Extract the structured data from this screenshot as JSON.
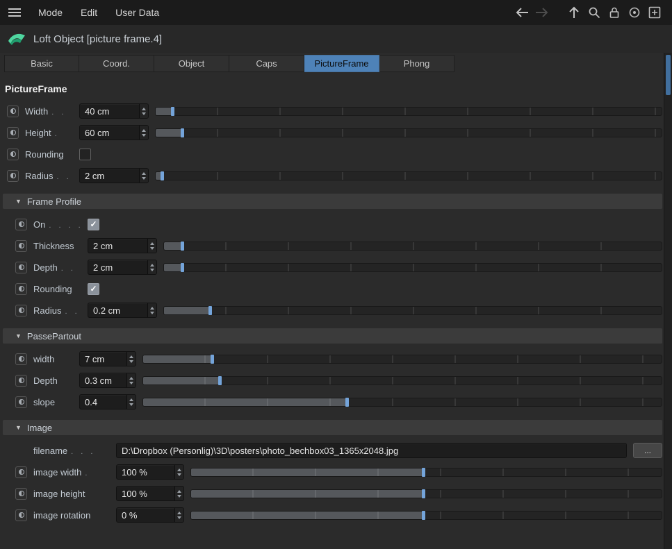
{
  "menubar": {
    "items": [
      "Mode",
      "Edit",
      "User Data"
    ],
    "icons": [
      "hamburger-icon",
      "back-icon",
      "forward-icon",
      "up-icon",
      "search-icon",
      "lock-icon",
      "target-icon",
      "add-box-icon"
    ]
  },
  "header": {
    "icon": "loft-object-icon",
    "title": "Loft Object [picture frame.4]"
  },
  "tabs": [
    {
      "label": "Basic",
      "selected": false
    },
    {
      "label": "Coord.",
      "selected": false
    },
    {
      "label": "Object",
      "selected": false
    },
    {
      "label": "Caps",
      "selected": false
    },
    {
      "label": "PictureFrame",
      "selected": true
    },
    {
      "label": "Phong",
      "selected": false
    }
  ],
  "panel": {
    "heading": "PictureFrame",
    "top": {
      "width": {
        "label": "Width",
        "leader": ". .",
        "value": "40 cm"
      },
      "height": {
        "label": "Height",
        "leader": ".",
        "value": "60 cm"
      },
      "rounding": {
        "label": "Rounding",
        "leader": "",
        "checked": false
      },
      "radius": {
        "label": "Radius",
        "leader": ". .",
        "value": "2 cm"
      }
    },
    "frame_profile": {
      "title": "Frame Profile",
      "on": {
        "label": "On",
        "leader": ". . . .",
        "checked": true
      },
      "thickness": {
        "label": "Thickness",
        "leader": "",
        "value": "2 cm"
      },
      "depth": {
        "label": "Depth",
        "leader": ". .",
        "value": "2 cm"
      },
      "rounding": {
        "label": "Rounding",
        "leader": "",
        "checked": true
      },
      "radius": {
        "label": "Radius",
        "leader": ". .",
        "value": "0.2 cm"
      }
    },
    "passepartout": {
      "title": "PassePartout",
      "width": {
        "label": "width",
        "leader": "",
        "value": "7 cm"
      },
      "depth": {
        "label": "Depth",
        "leader": "",
        "value": "0.3 cm"
      },
      "slope": {
        "label": "slope",
        "leader": "",
        "value": "0.4"
      }
    },
    "image": {
      "title": "Image",
      "filename": {
        "label": "filename",
        "leader": ". . .",
        "value": "D:\\Dropbox (Personlig)\\3D\\posters\\photo_bechbox03_1365x2048.jpg",
        "browse_label": "..."
      },
      "image_width": {
        "label": "image width",
        "leader": ".",
        "value": "100 %"
      },
      "image_height": {
        "label": "image height",
        "leader": "",
        "value": "100 %"
      },
      "image_rotation": {
        "label": "image rotation",
        "leader": "",
        "value": "0 %"
      }
    }
  },
  "colors": {
    "selected_tab": "#4e82b8",
    "slider_handle": "#74a4da",
    "panel_bg": "#2b2b2b"
  }
}
